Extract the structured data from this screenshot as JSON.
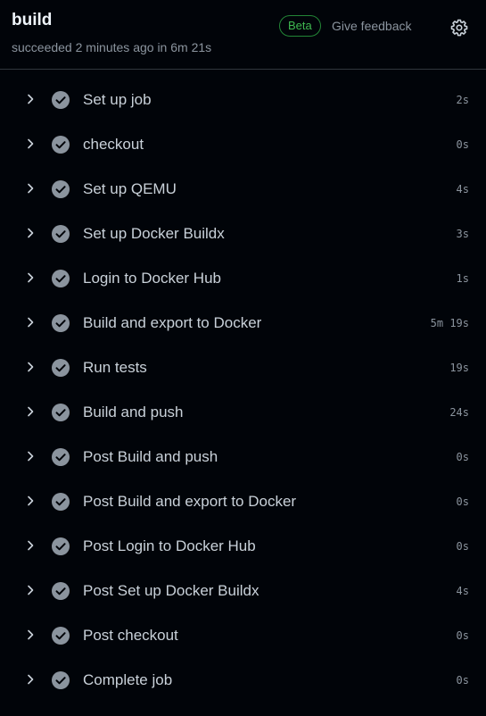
{
  "header": {
    "title": "build",
    "status": "succeeded 2 minutes ago in 6m 21s",
    "beta_label": "Beta",
    "feedback_label": "Give feedback",
    "settings_icon": "gear-icon"
  },
  "colors": {
    "background": "#010409",
    "success_badge": "#3fb950",
    "check_icon": "#8b949e"
  },
  "steps": [
    {
      "name": "Set up job",
      "duration": "2s"
    },
    {
      "name": "checkout",
      "duration": "0s"
    },
    {
      "name": "Set up QEMU",
      "duration": "4s"
    },
    {
      "name": "Set up Docker Buildx",
      "duration": "3s"
    },
    {
      "name": "Login to Docker Hub",
      "duration": "1s"
    },
    {
      "name": "Build and export to Docker",
      "duration": "5m 19s"
    },
    {
      "name": "Run tests",
      "duration": "19s"
    },
    {
      "name": "Build and push",
      "duration": "24s"
    },
    {
      "name": "Post Build and push",
      "duration": "0s"
    },
    {
      "name": "Post Build and export to Docker",
      "duration": "0s"
    },
    {
      "name": "Post Login to Docker Hub",
      "duration": "0s"
    },
    {
      "name": "Post Set up Docker Buildx",
      "duration": "4s"
    },
    {
      "name": "Post checkout",
      "duration": "0s"
    },
    {
      "name": "Complete job",
      "duration": "0s"
    }
  ]
}
